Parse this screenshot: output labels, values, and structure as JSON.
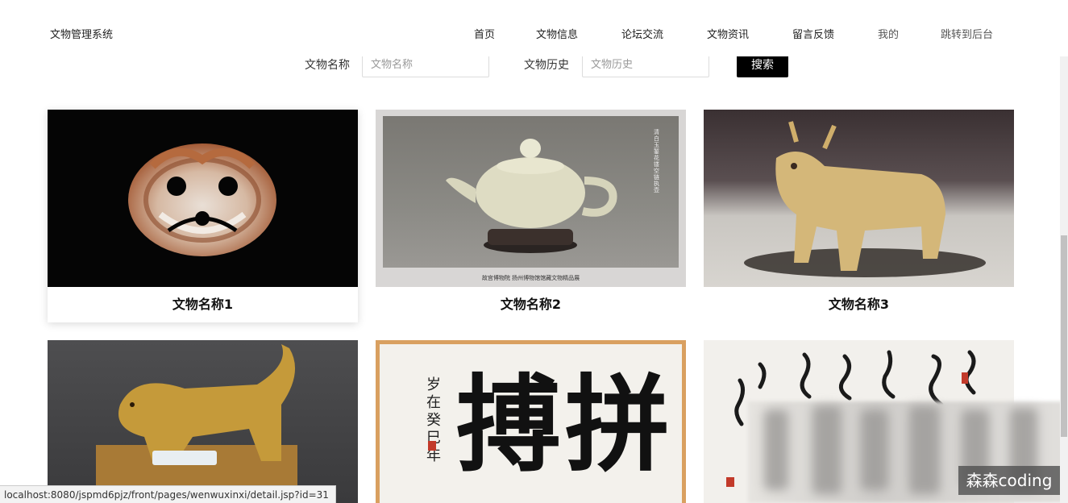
{
  "header": {
    "site_title": "文物管理系统",
    "nav": [
      "首页",
      "文物信息",
      "论坛交流",
      "文物资讯",
      "留言反馈",
      "我的",
      "跳转到后台"
    ]
  },
  "search": {
    "name_label": "文物名称",
    "name_placeholder": "文物名称",
    "history_label": "文物历史",
    "history_placeholder": "文物历史",
    "button_label": "搜索"
  },
  "cards": [
    {
      "title": "文物名称1"
    },
    {
      "title": "文物名称2"
    },
    {
      "title": "文物名称3"
    },
    {
      "title": ""
    },
    {
      "title": ""
    },
    {
      "title": ""
    }
  ],
  "images": {
    "teapot_caption": "故宫博物院 扬州博物馆馆藏文物精品展",
    "teapot_side_text": "清白玉錾花镂空链执壶"
  },
  "calligraphy": {
    "main_chars": [
      "搏",
      "拼"
    ],
    "side_text": "岁在癸巳年"
  },
  "status_bar": {
    "url": "localhost:8080/jspmd6pjz/front/pages/wenwuxinxi/detail.jsp?id=31"
  },
  "watermark": {
    "text": "森森coding"
  }
}
